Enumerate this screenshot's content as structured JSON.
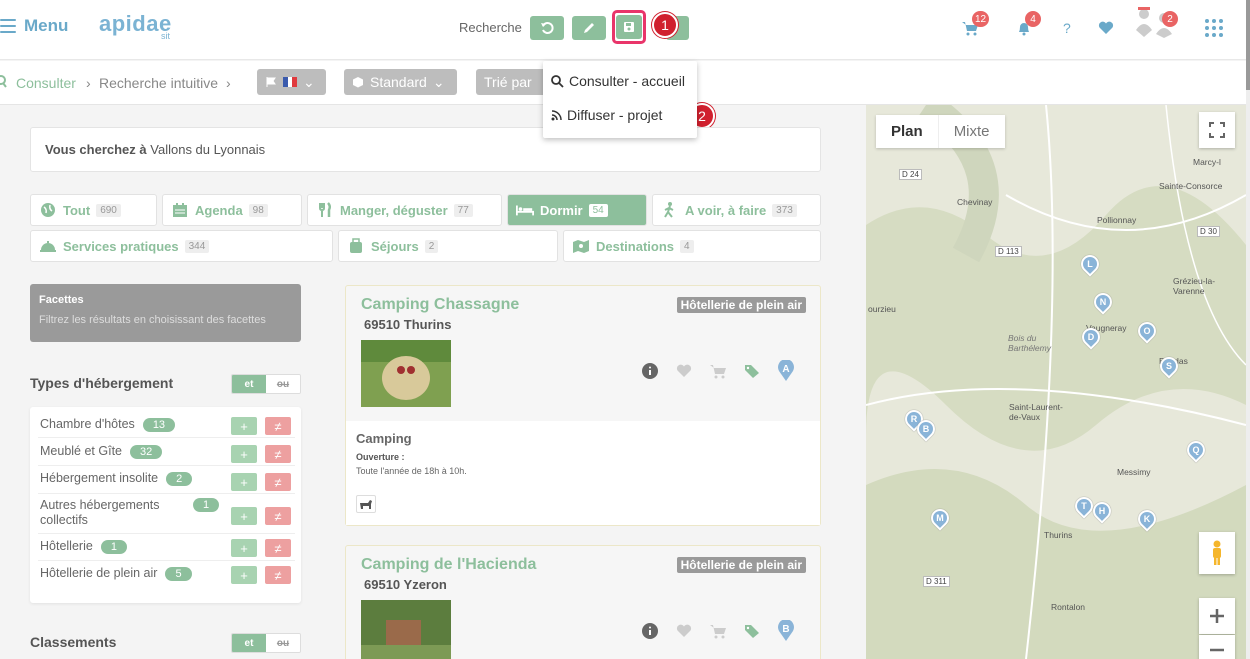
{
  "header": {
    "menu_label": "Menu",
    "logo": "apidae",
    "logo_sub": "sit",
    "search_label": "Recherche",
    "cart_count": "12",
    "bell_count": "4",
    "help": "?",
    "users_count": "2"
  },
  "annotations": {
    "one": "1",
    "two": "2"
  },
  "breadcrumb": {
    "consulter": "Consulter",
    "recherche": "Recherche intuitive",
    "mode": "Standard",
    "sort": "Trié par"
  },
  "dropdown": {
    "item1": "Consulter - accueil",
    "item2": "Diffuser - projet"
  },
  "search": {
    "prefix": "Vous cherchez à",
    "place": "Vallons du Lyonnais"
  },
  "tabs": [
    {
      "label": "Tout",
      "count": "690"
    },
    {
      "label": "Agenda",
      "count": "98"
    },
    {
      "label": "Manger, déguster",
      "count": "77"
    },
    {
      "label": "Dormir",
      "count": "54"
    },
    {
      "label": "A voir, à faire",
      "count": "373"
    },
    {
      "label": "Services pratiques",
      "count": "344"
    },
    {
      "label": "Séjours",
      "count": "2"
    },
    {
      "label": "Destinations",
      "count": "4"
    }
  ],
  "facets": {
    "title": "Facettes",
    "subtitle": "Filtrez les résultats en choisissant des facettes",
    "et": "et",
    "ou": "ou",
    "plus": "+",
    "neq": "≠",
    "heb_title": "Types d'hébergement",
    "heb_items": [
      {
        "label": "Chambre d'hôtes",
        "count": "13"
      },
      {
        "label": "Meublé et Gîte",
        "count": "32"
      },
      {
        "label": "Hébergement insolite",
        "count": "2"
      },
      {
        "label": "Autres hébergements collectifs",
        "count": "1"
      },
      {
        "label": "Hôtellerie",
        "count": "1"
      },
      {
        "label": "Hôtellerie de plein air",
        "count": "5"
      }
    ],
    "class_title": "Classements"
  },
  "cards": [
    {
      "title": "Camping Chassagne",
      "address": "69510 Thurins",
      "type": "Hôtellerie de plein air",
      "marker": "A",
      "category": "Camping",
      "opening_label": "Ouverture :",
      "opening": "Toute l'année de 18h à 10h."
    },
    {
      "title": "Camping de l'Hacienda",
      "address": "69510 Yzeron",
      "type": "Hôtellerie de plein air",
      "marker": "B"
    }
  ],
  "map": {
    "plan": "Plan",
    "mixte": "Mixte",
    "places": [
      "Marcy-l",
      "Sainte-Consorce",
      "Chevinay",
      "Pollionnay",
      "Grézieu-la-Varenne",
      "Vaugneray",
      "Bois du Barthélemy",
      "Brindas",
      "Saint-Laurent-de-Vaux",
      "Messimy",
      "Thurins",
      "Rontalon",
      "ourzieu"
    ],
    "roads": [
      "D 24",
      "D 30",
      "D 113",
      "D 311"
    ],
    "pins": [
      "L",
      "N",
      "O",
      "D",
      "S",
      "R",
      "B",
      "Q",
      "T",
      "H",
      "M",
      "K"
    ]
  }
}
